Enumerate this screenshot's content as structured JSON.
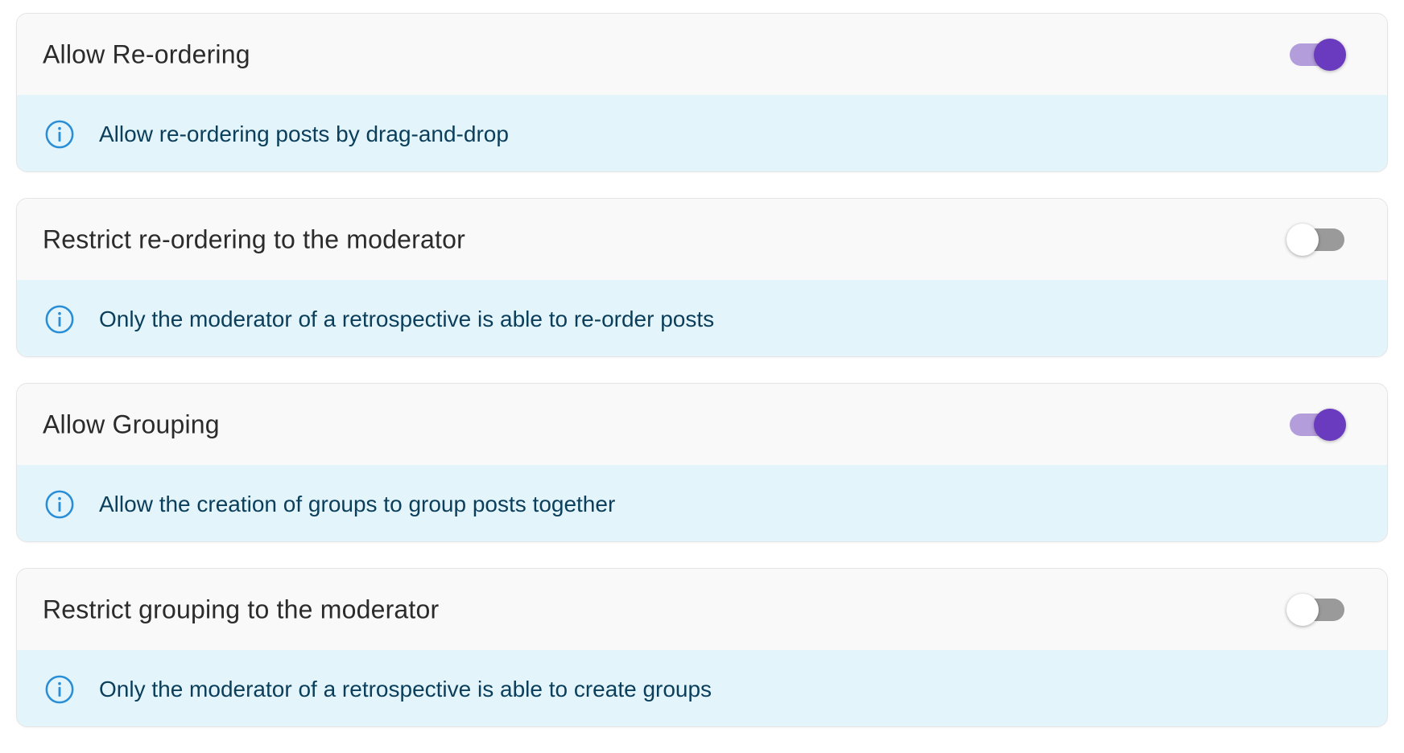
{
  "settings": [
    {
      "title": "Allow Re-ordering",
      "enabled": true,
      "info": "Allow re-ordering posts by drag-and-drop"
    },
    {
      "title": "Restrict re-ordering to the moderator",
      "enabled": false,
      "info": "Only the moderator of a retrospective is able to re-order posts"
    },
    {
      "title": "Allow Grouping",
      "enabled": true,
      "info": "Allow the creation of groups to group posts together"
    },
    {
      "title": "Restrict grouping to the moderator",
      "enabled": false,
      "info": "Only the moderator of a retrospective is able to create groups"
    }
  ],
  "icons": {
    "info": "info-circle-icon"
  },
  "colors": {
    "toggle_on_thumb": "#6a3bbf",
    "toggle_on_track": "#b39ddb",
    "toggle_off_track": "#9a9a9a",
    "info_background": "#e3f4fb",
    "info_text": "#0a3e5a",
    "info_icon": "#2a8ed6"
  }
}
